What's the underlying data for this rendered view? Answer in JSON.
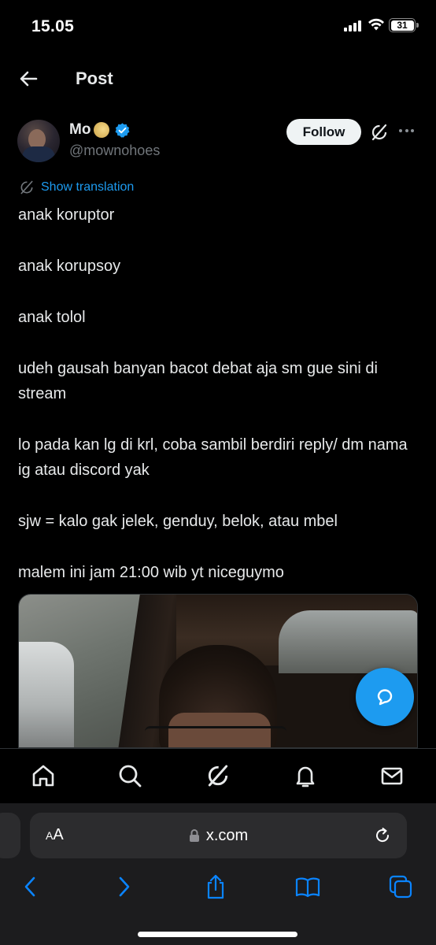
{
  "status_bar": {
    "time": "15.05",
    "battery": "31"
  },
  "header": {
    "title": "Post"
  },
  "author": {
    "name": "Mo",
    "handle": "@mownohoes",
    "follow_label": "Follow"
  },
  "translation": {
    "label": "Show translation"
  },
  "post": {
    "lines": [
      "anak koruptor",
      "anak korupsoy",
      "anak tolol",
      "udeh gausah banyan bacot debat aja sm gue sini di stream",
      "lo pada kan lg di krl, coba sambil berdiri reply/ dm nama ig atau discord yak",
      "sjw = kalo gak jelek, genduy, belok, atau mbel",
      "malem ini jam 21:00 wib yt niceguymo"
    ]
  },
  "browser": {
    "aa_label_small": "A",
    "aa_label_large": "A",
    "url": "x.com"
  },
  "colors": {
    "accent": "#1d9bf0",
    "background": "#000000",
    "text": "#e7e9ea",
    "muted": "#71767b",
    "safari_blue": "#0a84ff"
  },
  "icons": {
    "back": "arrow-left-icon",
    "verified": "verified-badge-icon",
    "grok": "grok-icon",
    "more": "more-icon",
    "translate": "grok-icon",
    "reply": "reply-icon",
    "home": "home-icon",
    "search": "search-icon",
    "notifications": "bell-icon",
    "messages": "mail-icon",
    "lock": "lock-icon",
    "reload": "reload-icon",
    "prev": "chevron-left-icon",
    "next": "chevron-right-icon",
    "share": "share-icon",
    "bookmarks": "book-icon",
    "tabs": "tabs-icon"
  }
}
